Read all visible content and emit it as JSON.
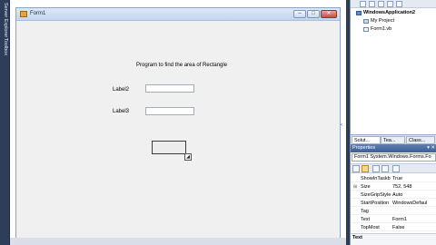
{
  "dock": {
    "server_explorer": "Server Explorer",
    "toolbox": "Toolbox"
  },
  "form": {
    "title": "Form1",
    "heading": "Program to find the area of Rectangle",
    "label2": "Label2",
    "label3": "Label3",
    "textbox1_value": "",
    "textbox2_value": "",
    "minimize": "–",
    "maximize": "□",
    "close": "✕",
    "smart_tag": "◢"
  },
  "solution_explorer": {
    "items": [
      {
        "label": "WindowsApplication2",
        "icon": "project-icon"
      },
      {
        "label": "My Project",
        "icon": "folder-icon"
      },
      {
        "label": "Form1.vb",
        "icon": "form-file-icon"
      }
    ]
  },
  "tabs": [
    {
      "label": "Solut...",
      "active": true
    },
    {
      "label": "Tea...",
      "active": false
    },
    {
      "label": "Class...",
      "active": false
    }
  ],
  "properties": {
    "title": "Properties",
    "header_controls": "▾ ✕",
    "object": "Form1  System.Windows.Forms.Fo",
    "rows": [
      {
        "name": "ShowInTaskb",
        "value": "True",
        "expander": ""
      },
      {
        "name": "Size",
        "value": "752, 548",
        "expander": "⊞"
      },
      {
        "name": "SizeGripStyle",
        "value": "Auto",
        "expander": ""
      },
      {
        "name": "StartPosition",
        "value": "WindowsDefaul",
        "expander": ""
      },
      {
        "name": "Tag",
        "value": "",
        "expander": ""
      },
      {
        "name": "Text",
        "value": "Form1",
        "expander": ""
      },
      {
        "name": "TopMost",
        "value": "False",
        "expander": ""
      }
    ],
    "description_title": "Text"
  },
  "colors": {
    "ide_background": "#2b3a55",
    "form_background": "#f0f0f0",
    "properties_header": "#4a6ba0",
    "close_button": "#c75038"
  }
}
